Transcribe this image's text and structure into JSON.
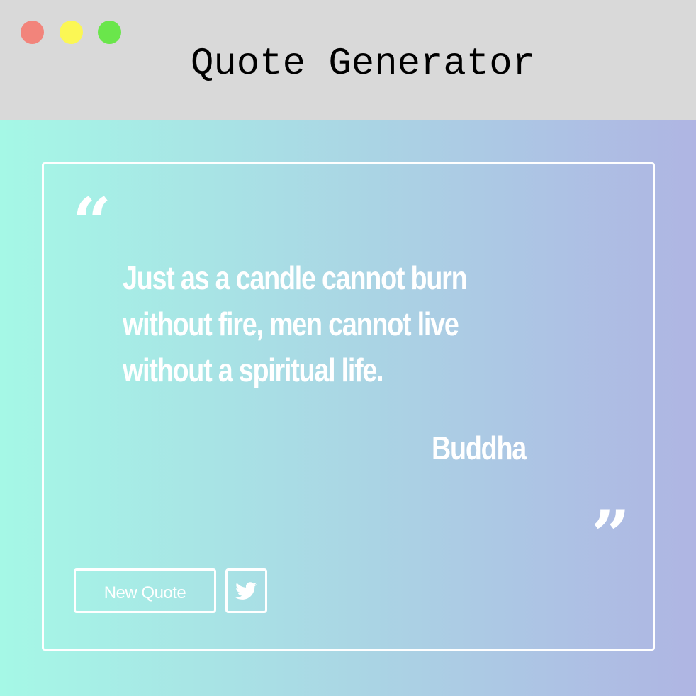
{
  "window": {
    "title": "Quote Generator",
    "controls": {
      "close_color": "#f2847b",
      "minimize_color": "#fbf754",
      "maximize_color": "#6ae64b"
    }
  },
  "colors": {
    "titlebar": "#d9d9d9",
    "gradient_start": "#a5f8e6",
    "gradient_end": "#afb5e3",
    "text": "#ffffff"
  },
  "quote": {
    "open_mark": "“",
    "lines": [
      "Just as a candle cannot burn",
      "without fire, men cannot live",
      "without a spiritual life."
    ],
    "author": "Buddha",
    "close_mark": "”"
  },
  "actions": {
    "new_quote_label": "New Quote",
    "tweet_icon": "twitter-icon"
  }
}
